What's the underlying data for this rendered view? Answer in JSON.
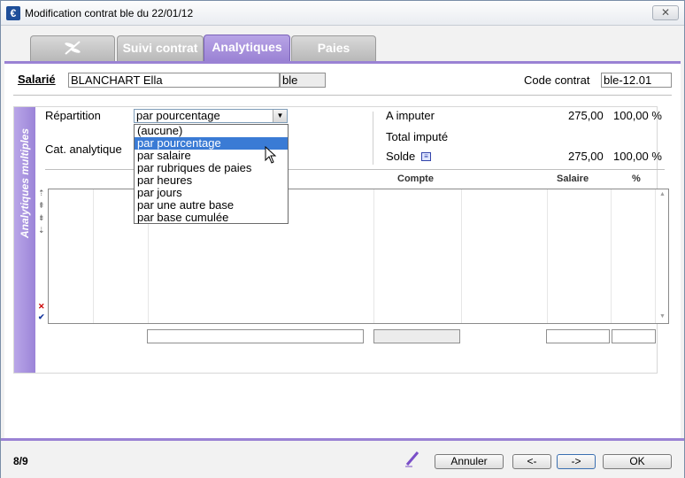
{
  "window": {
    "title": "Modification contrat ble du 22/01/12",
    "close_label": "✕"
  },
  "tabs": [
    {
      "label": "",
      "icon": "dragonfly-icon"
    },
    {
      "label": "Suivi contrat"
    },
    {
      "label": "Analytiques",
      "active": true
    },
    {
      "label": "Paies"
    }
  ],
  "header": {
    "salarie_label": "Salarié",
    "salarie_value": "BLANCHART Ella",
    "salarie_code": "ble",
    "code_contrat_label": "Code contrat",
    "code_contrat_value": "ble-12.01"
  },
  "panel": {
    "side_title": "Analytiques multiples",
    "repartition_label": "Répartition",
    "repartition_value": "par pourcentage",
    "cat_analytique_label": "Cat. analytique",
    "a_imputer_label": "A imputer",
    "a_imputer_amount": "275,00",
    "a_imputer_pct": "100,00 %",
    "total_impute_label": "Total imputé",
    "solde_label": "Solde",
    "solde_amount": "275,00",
    "solde_pct": "100,00 %"
  },
  "dropdown": {
    "options": [
      "(aucune)",
      "par pourcentage",
      "par salaire",
      "par rubriques de paies",
      "par heures",
      "par jours",
      "par une autre base",
      "par base cumulée"
    ],
    "selected_index": 1
  },
  "grid": {
    "columns": [
      "Compte",
      "Salaire",
      "%"
    ]
  },
  "footer": {
    "page_count": "8/9",
    "annuler_label": "Annuler",
    "prev_label": "<-",
    "next_label": "->",
    "ok_label": "OK"
  },
  "colors": {
    "accent": "#9a82d4",
    "selection": "#3a7bd5"
  }
}
